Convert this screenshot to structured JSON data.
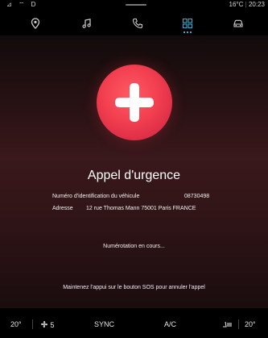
{
  "status_bar": {
    "left_icons": "⊿ ⌔ D",
    "temperature": "16°C",
    "time": "20:23"
  },
  "top_nav": {
    "items": [
      {
        "icon": "location-pin-icon"
      },
      {
        "icon": "music-note-icon"
      },
      {
        "icon": "phone-icon"
      },
      {
        "icon": "apps-grid-icon",
        "active": true
      },
      {
        "icon": "car-icon"
      }
    ],
    "active_color": "#3fa7c9"
  },
  "emergency": {
    "title": "Appel d'urgence",
    "vin_label": "Numéro d'identification du véhicule",
    "vin_value": "08730498",
    "address_label": "Adresse",
    "address_value": "12 rue Thomas Mann 75001 Paris FRANCE",
    "status": "Numérotation en cours...",
    "hint": "Maintenez l'appui sur le bouton SOS pour annuler l'appel",
    "accent": "#f23f4f"
  },
  "bottom_bar": {
    "temp_left": "20°",
    "fan_level": "5",
    "sync_label": "SYNC",
    "ac_label": "A/C",
    "temp_right": "20°"
  }
}
